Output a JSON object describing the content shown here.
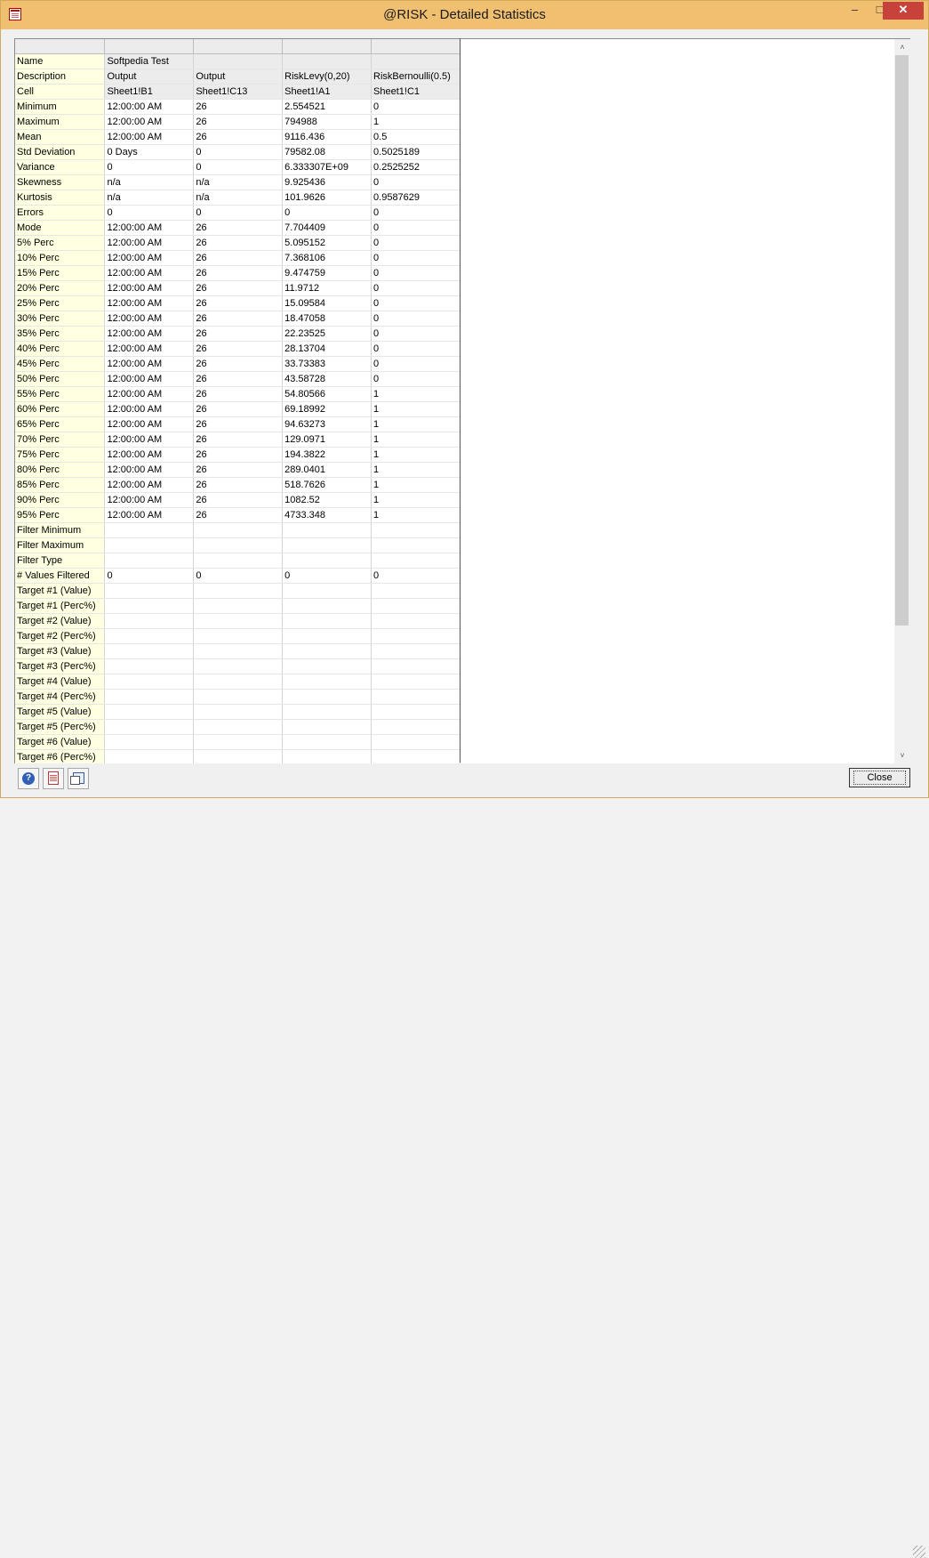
{
  "window": {
    "title": "@RISK - Detailed Statistics",
    "min_glyph": "–",
    "max_glyph": "□",
    "close_glyph": "✕"
  },
  "grid": {
    "meta": [
      [
        "Name",
        "Softpedia Test",
        "",
        "",
        ""
      ],
      [
        "Description",
        "Output",
        "Output",
        "RiskLevy(0,20)",
        "RiskBernoulli(0.5)"
      ],
      [
        "Cell",
        "Sheet1!B1",
        "Sheet1!C13",
        "Sheet1!A1",
        "Sheet1!C1"
      ]
    ],
    "rows": [
      [
        "Minimum",
        "12:00:00 AM",
        "26",
        "2.554521",
        "0"
      ],
      [
        "Maximum",
        "12:00:00 AM",
        "26",
        "794988",
        "1"
      ],
      [
        "Mean",
        "12:00:00 AM",
        "26",
        "9116.436",
        "0.5"
      ],
      [
        "Std Deviation",
        "0  Days",
        "0",
        "79582.08",
        "0.5025189"
      ],
      [
        "Variance",
        "0",
        "0",
        "6.333307E+09",
        "0.2525252"
      ],
      [
        "Skewness",
        "n/a",
        "n/a",
        "9.925436",
        "0"
      ],
      [
        "Kurtosis",
        "n/a",
        "n/a",
        "101.9626",
        "0.9587629"
      ],
      [
        "Errors",
        "0",
        "0",
        "0",
        "0"
      ],
      [
        "Mode",
        "12:00:00 AM",
        "26",
        "7.704409",
        "0"
      ],
      [
        "5% Perc",
        "12:00:00 AM",
        "26",
        "5.095152",
        "0"
      ],
      [
        "10% Perc",
        "12:00:00 AM",
        "26",
        "7.368106",
        "0"
      ],
      [
        "15% Perc",
        "12:00:00 AM",
        "26",
        "9.474759",
        "0"
      ],
      [
        "20% Perc",
        "12:00:00 AM",
        "26",
        "11.9712",
        "0"
      ],
      [
        "25% Perc",
        "12:00:00 AM",
        "26",
        "15.09584",
        "0"
      ],
      [
        "30% Perc",
        "12:00:00 AM",
        "26",
        "18.47058",
        "0"
      ],
      [
        "35% Perc",
        "12:00:00 AM",
        "26",
        "22.23525",
        "0"
      ],
      [
        "40% Perc",
        "12:00:00 AM",
        "26",
        "28.13704",
        "0"
      ],
      [
        "45% Perc",
        "12:00:00 AM",
        "26",
        "33.73383",
        "0"
      ],
      [
        "50% Perc",
        "12:00:00 AM",
        "26",
        "43.58728",
        "0"
      ],
      [
        "55% Perc",
        "12:00:00 AM",
        "26",
        "54.80566",
        "1"
      ],
      [
        "60% Perc",
        "12:00:00 AM",
        "26",
        "69.18992",
        "1"
      ],
      [
        "65% Perc",
        "12:00:00 AM",
        "26",
        "94.63273",
        "1"
      ],
      [
        "70% Perc",
        "12:00:00 AM",
        "26",
        "129.0971",
        "1"
      ],
      [
        "75% Perc",
        "12:00:00 AM",
        "26",
        "194.3822",
        "1"
      ],
      [
        "80% Perc",
        "12:00:00 AM",
        "26",
        "289.0401",
        "1"
      ],
      [
        "85% Perc",
        "12:00:00 AM",
        "26",
        "518.7626",
        "1"
      ],
      [
        "90% Perc",
        "12:00:00 AM",
        "26",
        "1082.52",
        "1"
      ],
      [
        "95% Perc",
        "12:00:00 AM",
        "26",
        "4733.348",
        "1"
      ],
      [
        "Filter Minimum",
        "",
        "",
        "",
        ""
      ],
      [
        "Filter Maximum",
        "",
        "",
        "",
        ""
      ],
      [
        "Filter Type",
        "",
        "",
        "",
        ""
      ],
      [
        "# Values Filtered",
        "0",
        "0",
        "0",
        "0"
      ],
      [
        "Target #1 (Value)",
        "",
        "",
        "",
        ""
      ],
      [
        "Target #1 (Perc%)",
        "",
        "",
        "",
        ""
      ],
      [
        "Target #2 (Value)",
        "",
        "",
        "",
        ""
      ],
      [
        "Target #2 (Perc%)",
        "",
        "",
        "",
        ""
      ],
      [
        "Target #3 (Value)",
        "",
        "",
        "",
        ""
      ],
      [
        "Target #3 (Perc%)",
        "",
        "",
        "",
        ""
      ],
      [
        "Target #4 (Value)",
        "",
        "",
        "",
        ""
      ],
      [
        "Target #4 (Perc%)",
        "",
        "",
        "",
        ""
      ],
      [
        "Target #5 (Value)",
        "",
        "",
        "",
        ""
      ],
      [
        "Target #5 (Perc%)",
        "",
        "",
        "",
        ""
      ],
      [
        "Target #6 (Value)",
        "",
        "",
        "",
        ""
      ],
      [
        "Target #6 (Perc%)",
        "",
        "",
        "",
        ""
      ]
    ]
  },
  "scrollbar": {
    "up_glyph": "˄",
    "down_glyph": "˅"
  },
  "toolbar": {
    "help_glyph": "?",
    "close_label": "Close"
  },
  "colors": {
    "title_bar": "#f0c070",
    "label_column": "#ffffe1",
    "close_button": "#c7423b"
  }
}
